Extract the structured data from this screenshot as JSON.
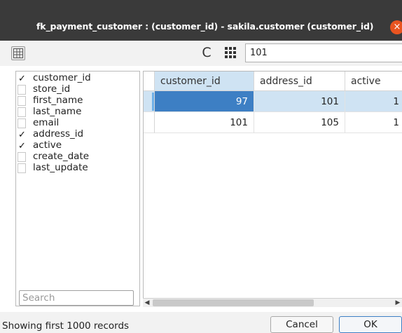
{
  "window": {
    "title": "fk_payment_customer : (customer_id) - sakila.customer (customer_id)",
    "close_glyph": "×"
  },
  "toolbar": {
    "columns_toggle_icon": "columns-panel-icon",
    "refresh_icon": "refresh-icon",
    "refresh_glyph": "C",
    "grid_icon": "grid-icon",
    "filter_value": "101"
  },
  "columns_panel": {
    "items": [
      {
        "label": "customer_id",
        "checked": true,
        "check_glyph": "✓"
      },
      {
        "label": "store_id",
        "checked": false,
        "check_glyph": ""
      },
      {
        "label": "first_name",
        "checked": false,
        "check_glyph": ""
      },
      {
        "label": "last_name",
        "checked": false,
        "check_glyph": ""
      },
      {
        "label": "email",
        "checked": false,
        "check_glyph": ""
      },
      {
        "label": "address_id",
        "checked": true,
        "check_glyph": "✓"
      },
      {
        "label": "active",
        "checked": true,
        "check_glyph": "✓"
      },
      {
        "label": "create_date",
        "checked": false,
        "check_glyph": ""
      },
      {
        "label": "last_update",
        "checked": false,
        "check_glyph": ""
      }
    ],
    "search_placeholder": "Search"
  },
  "grid": {
    "columns": [
      "customer_id",
      "address_id",
      "active"
    ],
    "rows": [
      [
        "97",
        "101",
        "1"
      ],
      [
        "101",
        "105",
        "1"
      ]
    ],
    "selected_row": 0,
    "focused_cell": "customer_id"
  },
  "scrollbar": {
    "left_arrow": "◀",
    "right_arrow": "▶"
  },
  "status": {
    "text": "Showing first 1000 records"
  },
  "buttons": {
    "cancel": "Cancel",
    "ok": "OK"
  },
  "colors": {
    "titlebar": "#3a3a3a",
    "close": "#e95420",
    "selection": "#3d7fc4",
    "row_highlight": "#cfe3f3"
  }
}
